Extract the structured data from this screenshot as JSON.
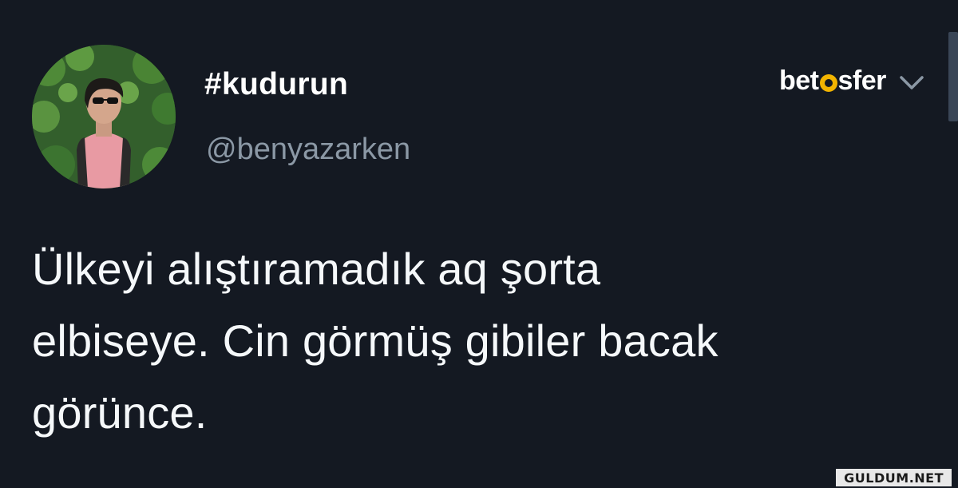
{
  "account": {
    "display_name": "#kudurun",
    "handle": "@benyazarken"
  },
  "brand": {
    "name_prefix": "bet",
    "name_suffix": "sfer",
    "icon": "chevron-down-icon",
    "accent_color": "#f2b400"
  },
  "tweet": {
    "lines": [
      "Ülkeyi alıştıramadık aq şorta",
      "elbiseye. Cin görmüş gibiler bacak",
      "görünce."
    ]
  },
  "watermark": {
    "text": "GULDUM.NET"
  },
  "colors": {
    "background": "#141922",
    "handle": "#8b98a5",
    "text": "#f5f8fa"
  }
}
